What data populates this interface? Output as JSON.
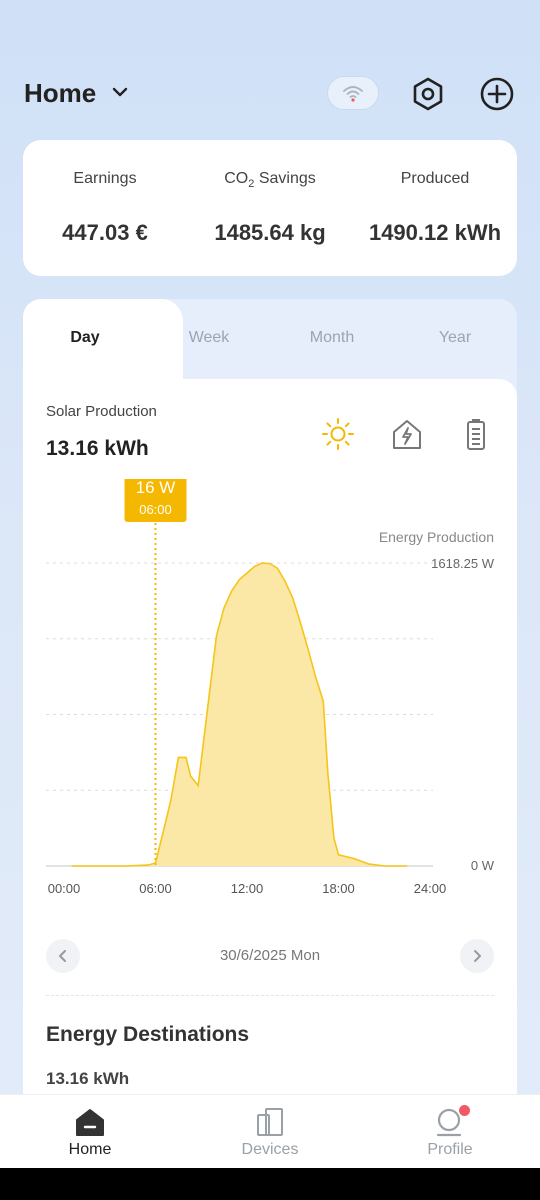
{
  "header": {
    "title": "Home",
    "icons": [
      "chevron-down-icon",
      "wifi-icon",
      "hexagon-settings-icon",
      "plus-circle-icon"
    ]
  },
  "stats": {
    "earnings_label": "Earnings",
    "earnings_value": "447.03 €",
    "co2_label_prefix": "CO",
    "co2_label_sub": "2",
    "co2_label_suffix": " Savings",
    "co2_value": "1485.64 kg",
    "produced_label": "Produced",
    "produced_value": "1490.12 kWh"
  },
  "tabs": [
    {
      "label": "Day",
      "active": true
    },
    {
      "label": "Week",
      "active": false
    },
    {
      "label": "Month",
      "active": false
    },
    {
      "label": "Year",
      "active": false
    }
  ],
  "solar": {
    "label": "Solar Production",
    "value": "13.16 kWh",
    "mode_icons": [
      "sun-icon",
      "house-lightning-icon",
      "battery-icon"
    ]
  },
  "chart_data": {
    "type": "area",
    "series_label": "Energy Production",
    "y_max_label": "1618.25 W",
    "y_min_label": "0 W",
    "ylim": [
      0,
      1618.25
    ],
    "xlim": [
      0,
      24
    ],
    "x_ticks": [
      "00:00",
      "06:00",
      "12:00",
      "18:00",
      "24:00"
    ],
    "x": [
      0.5,
      2,
      4,
      5.5,
      6,
      6.5,
      7,
      7.5,
      8,
      8.3,
      8.8,
      9.5,
      10,
      10.5,
      11,
      11.5,
      12,
      12.5,
      13,
      13.5,
      14,
      14.5,
      15,
      15.5,
      16,
      16.5,
      17,
      17.3,
      17.7,
      18,
      19,
      20,
      21,
      22.5
    ],
    "y": [
      0,
      0,
      0,
      5,
      16,
      180,
      350,
      580,
      580,
      480,
      430,
      900,
      1230,
      1380,
      1470,
      1530,
      1565,
      1600,
      1618,
      1615,
      1590,
      1520,
      1430,
      1300,
      1160,
      1010,
      880,
      500,
      150,
      60,
      40,
      10,
      0,
      0
    ],
    "color": "#f5c518",
    "fill": "#fbe8a6",
    "tooltip": {
      "value": "16 W",
      "time": "06:00",
      "x": 6
    }
  },
  "date_nav": {
    "date": "30/6/2025 Mon"
  },
  "destinations": {
    "title": "Energy Destinations",
    "value": "13.16 kWh"
  },
  "bottom_nav": [
    {
      "label": "Home",
      "icon": "home-icon",
      "active": true
    },
    {
      "label": "Devices",
      "icon": "devices-icon",
      "active": false
    },
    {
      "label": "Profile",
      "icon": "profile-icon",
      "active": false
    }
  ],
  "colors": {
    "accent": "#f5b800",
    "background": "#dbe7f8",
    "notification": "#f25a63"
  }
}
